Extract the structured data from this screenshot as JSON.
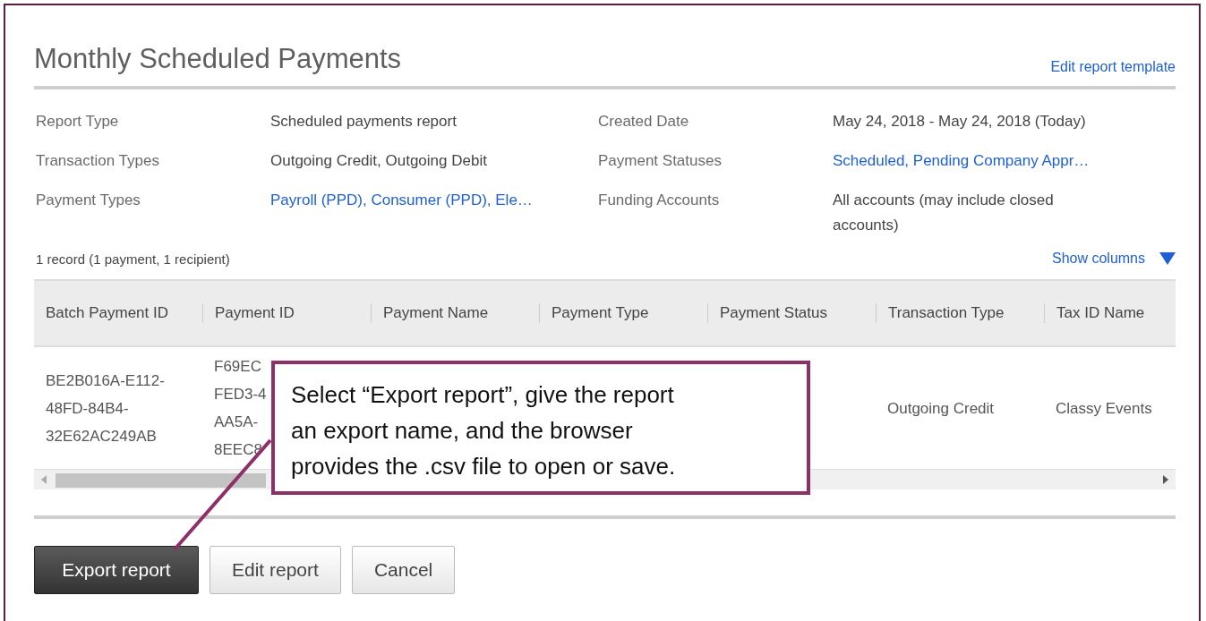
{
  "report": {
    "title": "Monthly Scheduled Payments",
    "edit_template_link": "Edit report template"
  },
  "details": [
    {
      "label": "Report Type",
      "value": "Scheduled payments report",
      "link": false
    },
    {
      "label": "Created Date",
      "value": "May 24, 2018 - May 24, 2018 (Today)",
      "link": false
    },
    {
      "label": "Transaction Types",
      "value": "Outgoing Credit, Outgoing Debit",
      "link": false
    },
    {
      "label": "Payment Statuses",
      "value": "Scheduled, Pending Company Appr…",
      "link": true
    },
    {
      "label": "Payment Types",
      "value": "Payroll (PPD), Consumer (PPD), Ele…",
      "link": true
    },
    {
      "label": "Funding Accounts",
      "value": "All accounts (may include closed accounts)",
      "link": false
    }
  ],
  "record_count": "1 record (1 payment, 1 recipient)",
  "show_columns": "Show columns",
  "table": {
    "columns": [
      "Batch Payment ID",
      "Payment ID",
      "Payment Name",
      "Payment Type",
      "Payment Status",
      "Transaction Type",
      "Tax ID Name"
    ],
    "rows": [
      {
        "cells": [
          [
            "BE2B016A-E112-",
            "48FD-84B4-",
            "32E62AC249AB"
          ],
          [
            "F69EC",
            "FED3-4",
            "AA5A-",
            "8EEC8"
          ],
          null,
          null,
          null,
          [
            "Outgoing Credit"
          ],
          [
            "Classy Events"
          ]
        ]
      }
    ]
  },
  "buttons": [
    {
      "label": "Export report",
      "kind": "primary"
    },
    {
      "label": "Edit report",
      "kind": "secondary"
    },
    {
      "label": "Cancel",
      "kind": "secondary"
    }
  ],
  "callout": {
    "lines": [
      "Select “Export report”, give the report",
      "an export name, and the browser",
      "provides the .csv file to open or save."
    ]
  }
}
